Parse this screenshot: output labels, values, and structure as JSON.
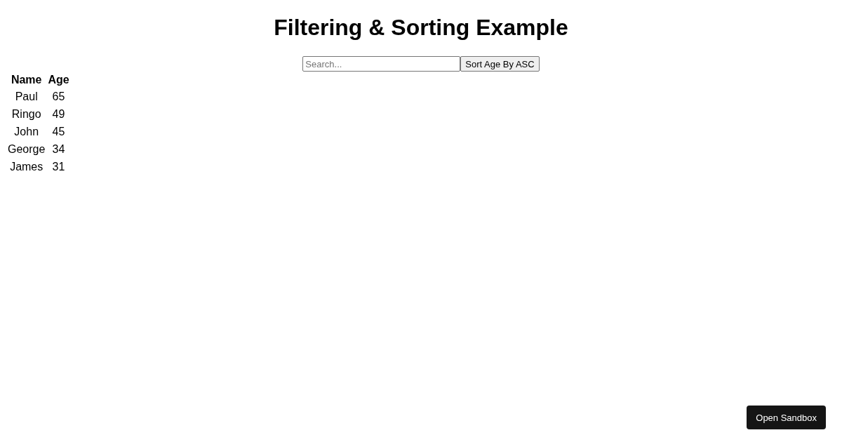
{
  "title": "Filtering & Sorting Example",
  "search": {
    "placeholder": "Search..."
  },
  "sort_button": {
    "label": "Sort Age By ASC"
  },
  "table": {
    "columns": [
      "Name",
      "Age"
    ],
    "rows": [
      [
        "Paul",
        "65"
      ],
      [
        "Ringo",
        "49"
      ],
      [
        "John",
        "45"
      ],
      [
        "George",
        "34"
      ],
      [
        "James",
        "31"
      ]
    ]
  },
  "sandbox_button": {
    "label": "Open Sandbox"
  }
}
